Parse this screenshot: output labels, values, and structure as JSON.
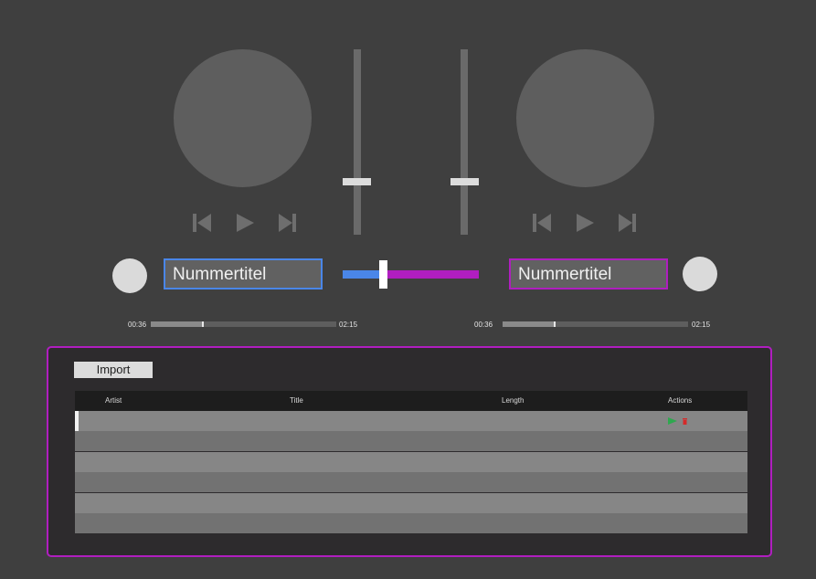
{
  "deck_left": {
    "title": "Nummertitel",
    "accent": "#4a86e8",
    "elapsed": "00:36",
    "total": "02:15",
    "progress": 0.28
  },
  "deck_right": {
    "title": "Nummertitel",
    "accent": "#b01ec0",
    "elapsed": "00:36",
    "total": "02:15",
    "progress": 0.28
  },
  "crossfader": {
    "position": 0.3,
    "left_color": "#4a86e8",
    "right_color": "#b01ec0"
  },
  "library": {
    "import_label": "Import",
    "columns": [
      "Artist",
      "Title",
      "Length",
      "Actions"
    ],
    "rows": 6,
    "action_icons": [
      "play-icon",
      "delete-icon"
    ],
    "colors": {
      "play": "#2fa84f",
      "delete": "#d62a2a",
      "border": "#b01ec0"
    }
  }
}
